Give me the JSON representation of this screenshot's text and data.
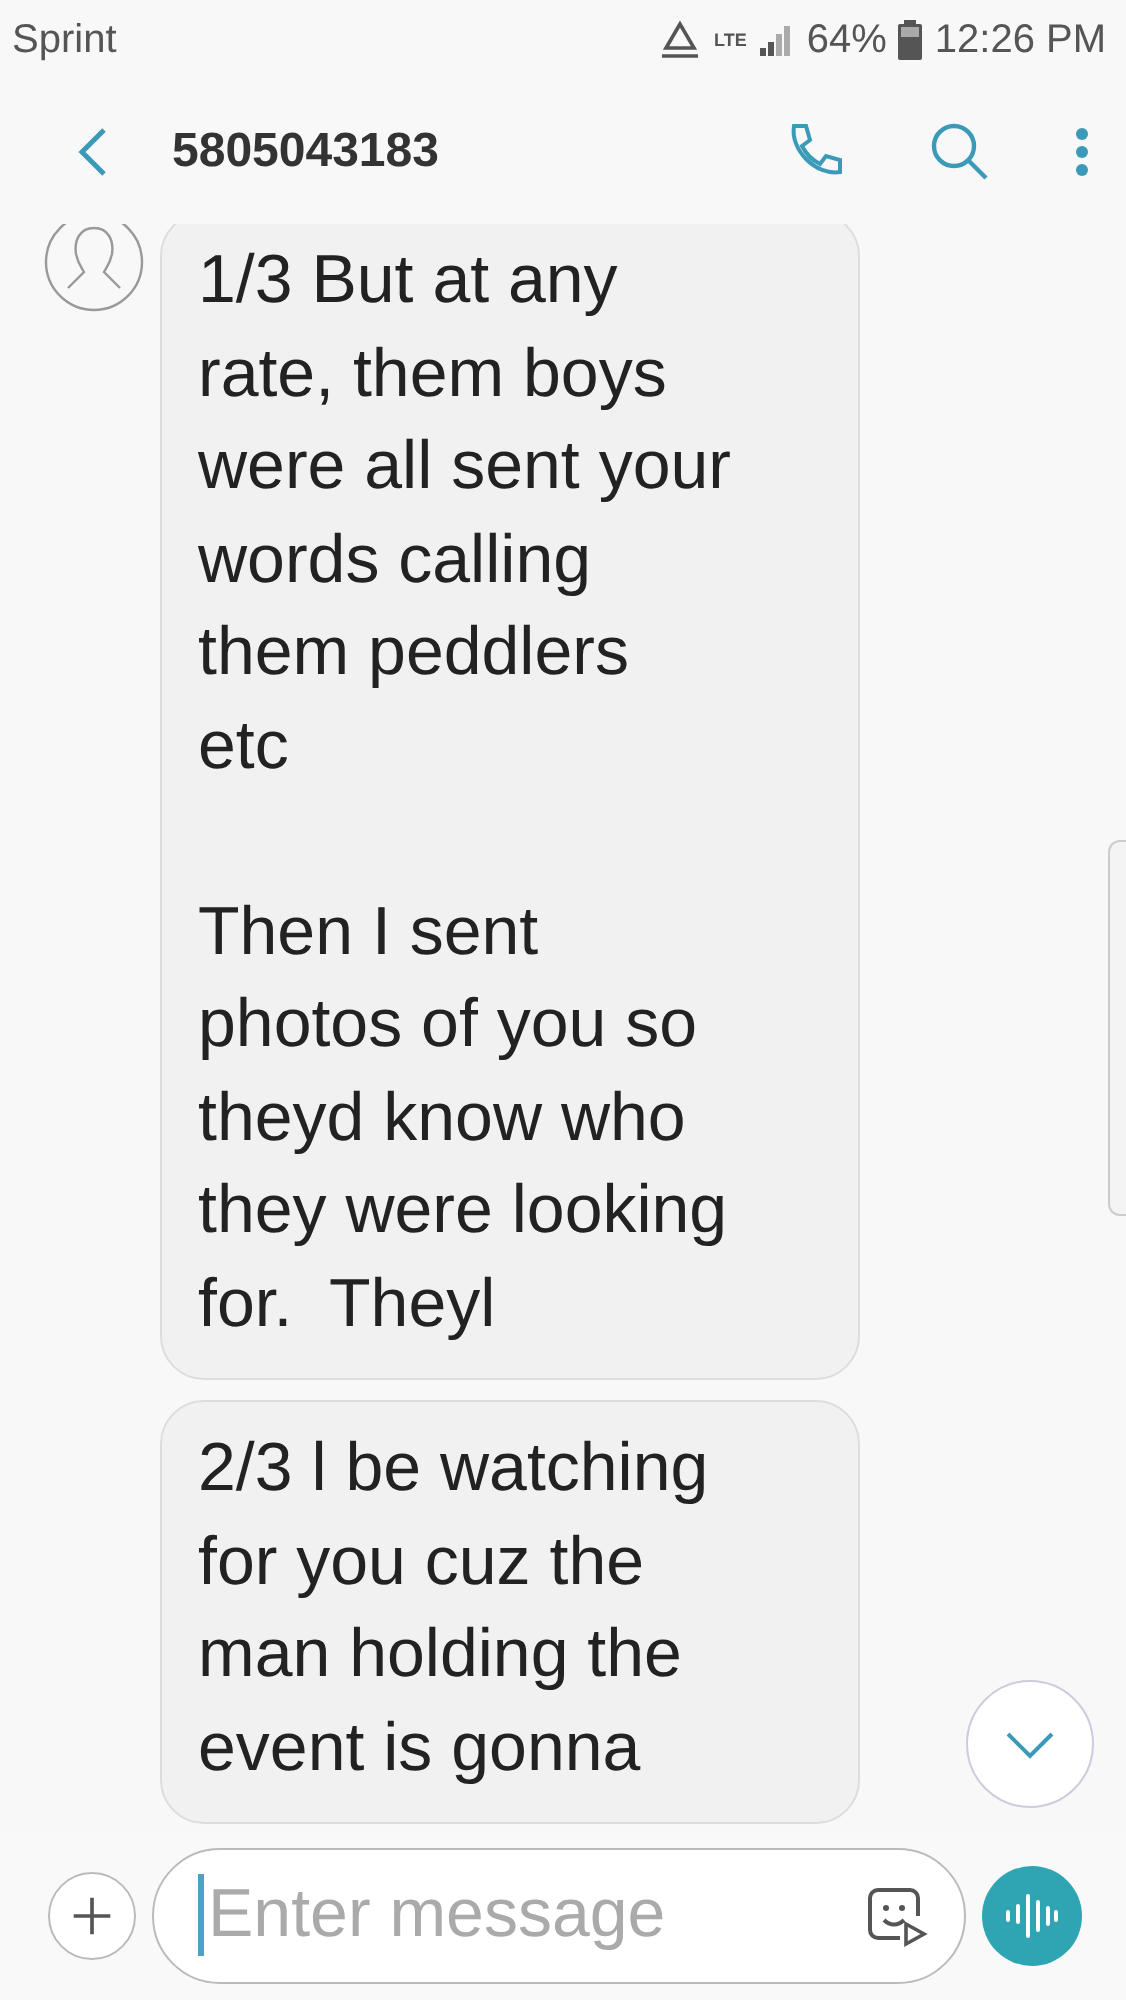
{
  "status_bar": {
    "carrier": "Sprint",
    "network": "LTE",
    "battery": "64%",
    "time": "12:26 PM"
  },
  "header": {
    "title": "5805043183"
  },
  "messages": [
    {
      "text": "1/3 But at any\nrate, them boys\nwere all sent your\nwords calling\nthem peddlers\netc\n\nThen I sent\nphotos of you so\ntheyd know who\nthey were looking\nfor.  Theyl",
      "avatar": true
    },
    {
      "text": "2/3 l be watching\nfor you cuz the\nman holding the\nevent is gonna",
      "avatar": false
    }
  ],
  "composer": {
    "placeholder": "Enter message"
  }
}
